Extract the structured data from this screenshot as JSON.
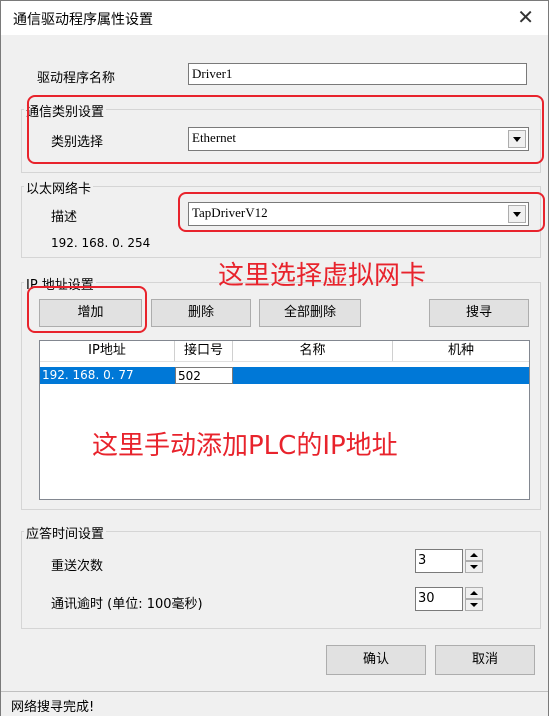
{
  "window": {
    "title": "通信驱动程序属性设置",
    "close_symbol": "✕"
  },
  "driver_name": {
    "label": "驱动程序名称",
    "value": "Driver1"
  },
  "comm_type": {
    "group_title": "通信类别设置",
    "label": "类别选择",
    "selected": "Ethernet"
  },
  "ethernet_card": {
    "group_title": "以太网络卡",
    "label": "描述",
    "selected": "TapDriverV12",
    "ip": "192. 168. 0. 254"
  },
  "ip_settings": {
    "group_title": "IP 地址设置",
    "buttons": {
      "add": "增加",
      "delete": "删除",
      "delete_all": "全部删除",
      "search": "搜寻"
    },
    "columns": [
      "IP地址",
      "接口号",
      "名称",
      "机种"
    ],
    "rows": [
      {
        "ip": "192. 168. 0. 77",
        "port": "502",
        "name": "",
        "model": ""
      }
    ]
  },
  "response": {
    "group_title": "应答时间设置",
    "retry_label": "重送次数",
    "retry_value": "3",
    "timeout_label": "通讯逾时 (单位: 100毫秒)",
    "timeout_value": "30"
  },
  "footer": {
    "ok": "确认",
    "cancel": "取消"
  },
  "status_text": "网络搜寻完成!",
  "annotations": {
    "select_nic": "这里选择虚拟网卡",
    "add_ip": "这里手动添加PLC的IP地址"
  },
  "colors": {
    "highlight": "#e8232c",
    "selection": "#0078d7"
  }
}
